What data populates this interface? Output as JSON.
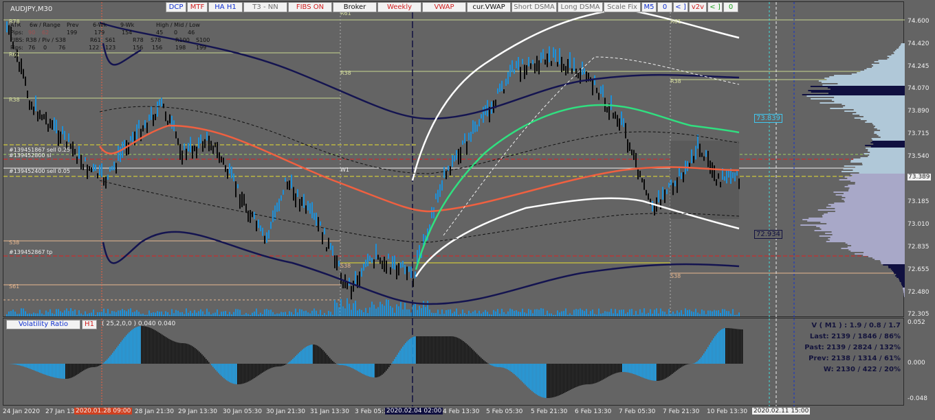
{
  "symbol": "AUDJPY,M30",
  "toolbar": [
    {
      "label": "DCP",
      "color": "#1030d0"
    },
    {
      "label": "MTF",
      "color": "#d02020"
    },
    {
      "label": "HA H1",
      "color": "#1030d0"
    },
    {
      "label": "T3 - NN",
      "color": "#707070"
    },
    {
      "label": "FIBS ON",
      "color": "#d02020"
    },
    {
      "label": "Broker",
      "color": "#101010"
    },
    {
      "label": "Weekly",
      "color": "#d02020"
    },
    {
      "label": "VWAP",
      "color": "#d02020"
    },
    {
      "label": "cur.VWAP",
      "color": "#101010"
    },
    {
      "label": "Short DSMA",
      "color": "#707070"
    },
    {
      "label": "Long DSMA",
      "color": "#707070"
    },
    {
      "label": "Scale Fix",
      "color": "#707070"
    },
    {
      "label": "M5",
      "color": "#1030d0"
    },
    {
      "label": "0",
      "color": "#1030d0"
    },
    {
      "label": "< ]",
      "color": "#1030d0"
    },
    {
      "label": "v2v",
      "color": "#d02020"
    },
    {
      "label": "< ]",
      "color": "#20a020"
    },
    {
      "label": "0",
      "color": "#20a020"
    }
  ],
  "info": {
    "row1": [
      "ATR",
      "6w / Range",
      "Prev",
      "6-Wk",
      "9-Wk",
      "High / Mid / Low"
    ],
    "row2": [
      "Pips:",
      "90",
      "62",
      "199",
      "179",
      "154",
      "45",
      "0",
      "46"
    ],
    "row3": [
      "FIBS: R38 / Piv / S38",
      "R61",
      "S61",
      "R78",
      "S78",
      "R100",
      "S100"
    ],
    "row4": [
      "Pips:",
      "76",
      "0",
      "76",
      "122",
      "123",
      "156",
      "156",
      "198",
      "199"
    ]
  },
  "price_axis": [
    "74.600",
    "74.420",
    "74.245",
    "74.070",
    "73.890",
    "73.715",
    "73.540",
    "73.365",
    "73.185",
    "73.010",
    "72.835",
    "72.655",
    "72.480",
    "72.305"
  ],
  "current_price": "73.389",
  "price_tag_upper": "73.839",
  "price_tag_lower": "72.934",
  "level_labels": {
    "r61_left": "R61",
    "r38_left": "R38",
    "s38_left": "S38",
    "s61_left": "S61",
    "r61_mid": "R61",
    "r38_mid": "R38",
    "w1": "W1",
    "s38_mid": "S38",
    "r61_right": "R61",
    "r38_right": "R38",
    "s38_right": "S38",
    "r78_top": "R78"
  },
  "orders": [
    "#139451867 sell 0.25",
    "#139452800 sl",
    "#139452400 sell 0.05",
    "#139452867 tp"
  ],
  "time_axis": [
    {
      "text": "24 Jan 2020",
      "style": ""
    },
    {
      "text": "27 Jan 13",
      "style": ""
    },
    {
      "text": "2020.01.28 09:00",
      "style": "hl"
    },
    {
      "text": "28 Jan 21:30",
      "style": ""
    },
    {
      "text": "29 Jan 13:30",
      "style": ""
    },
    {
      "text": "30 Jan 05:30",
      "style": ""
    },
    {
      "text": "30 Jan 21:30",
      "style": ""
    },
    {
      "text": "31 Jan 13:30",
      "style": ""
    },
    {
      "text": "3 Feb 05:3",
      "style": ""
    },
    {
      "text": "2020.02.04 02:00",
      "style": "hl2"
    },
    {
      "text": "4 Feb 13:30",
      "style": ""
    },
    {
      "text": "5 Feb 05:30",
      "style": ""
    },
    {
      "text": "5 Feb 21:30",
      "style": ""
    },
    {
      "text": "6 Feb 13:30",
      "style": ""
    },
    {
      "text": "7 Feb 05:30",
      "style": ""
    },
    {
      "text": "7 Feb 21:30",
      "style": ""
    },
    {
      "text": "10 Feb 13:30",
      "style": ""
    },
    {
      "text": "2020.02.11 15:00",
      "style": "hl3"
    }
  ],
  "volatility": {
    "title": "Volatility Ratio",
    "timeframe": "H1",
    "params": "( 25,2,0,0 ) 0.040 0.040",
    "axis": [
      "0.052",
      "0.000",
      "-0.048"
    ]
  },
  "stats": {
    "v": "V ( M1 ) : 1.9 / 0.8 / 1.7",
    "last": "Last: 2139 / 1846 / 86%",
    "past": "Past: 2139 / 2824 / 132%",
    "prev": "Prev: 2138 / 1314 / 61%",
    "w": "W: 2130 / 422 / 20%"
  },
  "colors": {
    "background": "#646464",
    "bull_candle": "#1e90d8",
    "bear_candle": "#0a0a0a",
    "vwap": "#f06040",
    "band_inner": "#30e080",
    "band_outer": "#ffffff",
    "navy": "#141450"
  }
}
